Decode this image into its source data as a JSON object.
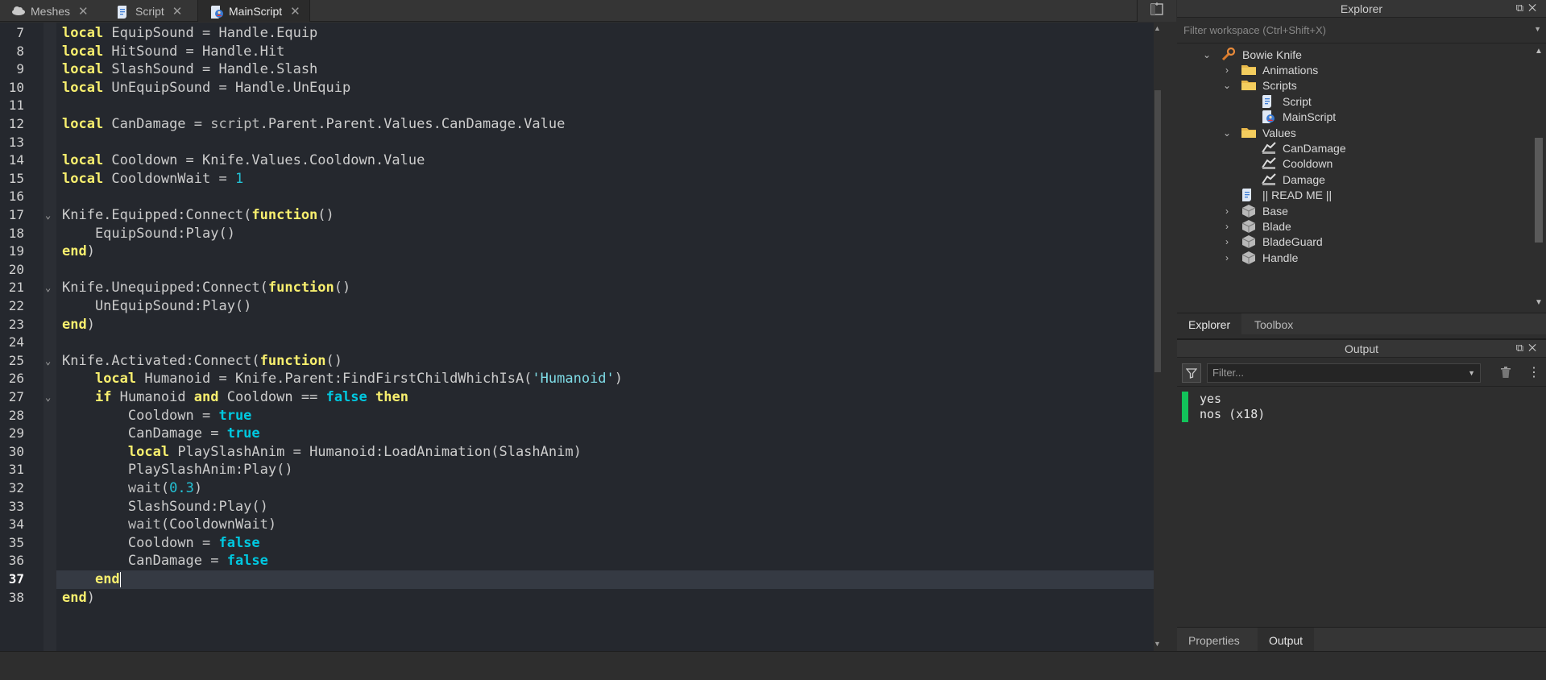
{
  "tabs": [
    {
      "label": "Meshes",
      "icon": "cloud-icon",
      "active": false
    },
    {
      "label": "Script",
      "icon": "script-icon",
      "active": false
    },
    {
      "label": "MainScript",
      "icon": "local-script-icon",
      "active": true
    }
  ],
  "editor": {
    "current_line": 37,
    "lines": [
      {
        "n": "7",
        "fold": false,
        "html": "<span class='kw'>local</span> EquipSound = Handle.Equip"
      },
      {
        "n": "8",
        "fold": false,
        "html": "<span class='kw'>local</span> HitSound = Handle.Hit"
      },
      {
        "n": "9",
        "fold": false,
        "html": "<span class='kw'>local</span> SlashSound = Handle.Slash"
      },
      {
        "n": "10",
        "fold": false,
        "html": "<span class='kw'>local</span> UnEquipSound = Handle.UnEquip"
      },
      {
        "n": "11",
        "fold": false,
        "html": ""
      },
      {
        "n": "12",
        "fold": false,
        "html": "<span class='kw'>local</span> CanDamage = <span class='bi'>script</span>.Parent.Parent.Values.CanDamage.Value"
      },
      {
        "n": "13",
        "fold": false,
        "html": ""
      },
      {
        "n": "14",
        "fold": false,
        "html": "<span class='kw'>local</span> Cooldown = Knife.Values.Cooldown.Value"
      },
      {
        "n": "15",
        "fold": false,
        "html": "<span class='kw'>local</span> CooldownWait = <span class='num'>1</span>"
      },
      {
        "n": "16",
        "fold": false,
        "html": ""
      },
      {
        "n": "17",
        "fold": true,
        "html": "Knife.Equipped:Connect(<span class='kw'>function</span>()"
      },
      {
        "n": "18",
        "fold": false,
        "html": "    EquipSound:Play()"
      },
      {
        "n": "19",
        "fold": false,
        "html": "<span class='kw'>end</span>)"
      },
      {
        "n": "20",
        "fold": false,
        "html": ""
      },
      {
        "n": "21",
        "fold": true,
        "html": "Knife.Unequipped:Connect(<span class='kw'>function</span>()"
      },
      {
        "n": "22",
        "fold": false,
        "html": "    UnEquipSound:Play()"
      },
      {
        "n": "23",
        "fold": false,
        "html": "<span class='kw'>end</span>)"
      },
      {
        "n": "24",
        "fold": false,
        "html": ""
      },
      {
        "n": "25",
        "fold": true,
        "html": "Knife.Activated:Connect(<span class='kw'>function</span>()"
      },
      {
        "n": "26",
        "fold": false,
        "html": "    <span class='kw'>local</span> Humanoid = Knife.Parent:FindFirstChildWhichIsA(<span class='str'>'Humanoid'</span>)"
      },
      {
        "n": "27",
        "fold": true,
        "html": "    <span class='kw'>if</span> Humanoid <span class='kw'>and</span> Cooldown == <span class='bool'>false</span> <span class='kw'>then</span>"
      },
      {
        "n": "28",
        "fold": false,
        "html": "        Cooldown = <span class='bool'>true</span>"
      },
      {
        "n": "29",
        "fold": false,
        "html": "        CanDamage = <span class='bool'>true</span>"
      },
      {
        "n": "30",
        "fold": false,
        "html": "        <span class='kw'>local</span> PlaySlashAnim = Humanoid:LoadAnimation(SlashAnim)"
      },
      {
        "n": "31",
        "fold": false,
        "html": "        PlaySlashAnim:Play()"
      },
      {
        "n": "32",
        "fold": false,
        "html": "        <span class='bi'>wait</span>(<span class='num'>0.3</span>)"
      },
      {
        "n": "33",
        "fold": false,
        "html": "        SlashSound:Play()"
      },
      {
        "n": "34",
        "fold": false,
        "html": "        <span class='bi'>wait</span>(CooldownWait)"
      },
      {
        "n": "35",
        "fold": false,
        "html": "        Cooldown = <span class='bool'>false</span>"
      },
      {
        "n": "36",
        "fold": false,
        "html": "        CanDamage = <span class='bool'>false</span>"
      },
      {
        "n": "37",
        "fold": false,
        "html": "    <span class='kw'>end</span><span class='caret'></span>"
      },
      {
        "n": "38",
        "fold": false,
        "html": "<span class='kw'>end</span>)"
      }
    ]
  },
  "explorer": {
    "title": "Explorer",
    "filter_placeholder": "Filter workspace (Ctrl+Shift+X)",
    "tree": [
      {
        "label": "Bowie Knife",
        "depth": 0,
        "expander": "expanded",
        "icon": "tool-icon"
      },
      {
        "label": "Animations",
        "depth": 1,
        "expander": "collapsed",
        "icon": "folder-icon"
      },
      {
        "label": "Scripts",
        "depth": 1,
        "expander": "expanded",
        "icon": "folder-icon"
      },
      {
        "label": "Script",
        "depth": 2,
        "expander": "none",
        "icon": "script-icon"
      },
      {
        "label": "MainScript",
        "depth": 2,
        "expander": "none",
        "icon": "local-script-icon"
      },
      {
        "label": "Values",
        "depth": 1,
        "expander": "expanded",
        "icon": "folder-icon"
      },
      {
        "label": "CanDamage",
        "depth": 2,
        "expander": "none",
        "icon": "value-icon"
      },
      {
        "label": "Cooldown",
        "depth": 2,
        "expander": "none",
        "icon": "value-icon"
      },
      {
        "label": "Damage",
        "depth": 2,
        "expander": "none",
        "icon": "value-icon"
      },
      {
        "label": "|| READ ME ||",
        "depth": 1,
        "expander": "none",
        "icon": "script-icon"
      },
      {
        "label": "Base",
        "depth": 1,
        "expander": "collapsed",
        "icon": "part-icon"
      },
      {
        "label": "Blade",
        "depth": 1,
        "expander": "collapsed",
        "icon": "part-icon"
      },
      {
        "label": "BladeGuard",
        "depth": 1,
        "expander": "collapsed",
        "icon": "part-icon"
      },
      {
        "label": "Handle",
        "depth": 1,
        "expander": "collapsed",
        "icon": "part-icon"
      }
    ],
    "tabs": [
      {
        "label": "Explorer",
        "active": true
      },
      {
        "label": "Toolbox",
        "active": false
      }
    ]
  },
  "output": {
    "title": "Output",
    "filter_placeholder": "Filter...",
    "lines": [
      "yes",
      "nos (x18)"
    ],
    "marker_color": "#12c45a",
    "tabs": [
      {
        "label": "Properties",
        "active": false
      },
      {
        "label": "Output",
        "active": true
      }
    ]
  }
}
